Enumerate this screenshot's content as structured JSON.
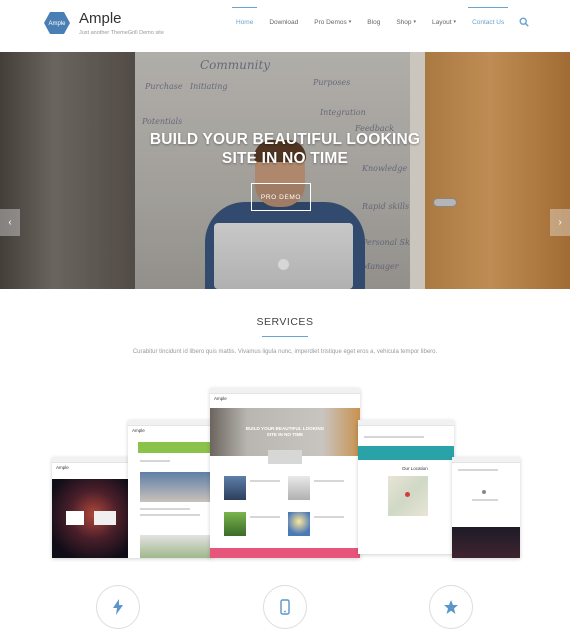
{
  "site": {
    "logo_text": "Ample",
    "title": "Ample",
    "tagline": "Just another ThemeGrill Demo site"
  },
  "nav": {
    "items": [
      {
        "label": "Home",
        "active": true
      },
      {
        "label": "Download"
      },
      {
        "label": "Pro Demos",
        "caret": "▾"
      },
      {
        "label": "Blog"
      },
      {
        "label": "Shop",
        "caret": "▾"
      },
      {
        "label": "Layout",
        "caret": "▾"
      },
      {
        "label": "Contact Us"
      }
    ]
  },
  "hero": {
    "title_line1": "BUILD YOUR BEAUTIFUL LOOKING",
    "title_line2": "SITE IN NO TIME",
    "button_label": "PRO DEMO",
    "prev_glyph": "‹",
    "next_glyph": "›",
    "whiteboard_words": [
      "Community",
      "Purchase",
      "Initiating",
      "Purposes",
      "Potentials",
      "Integration",
      "Feedback",
      "Knowledge",
      "Rapid skills",
      "Personal Skills",
      "Manager"
    ]
  },
  "services": {
    "title": "SERVICES",
    "description": "Curabitur tincidunt id libero quis mattis. Vivamus ligula nunc, imperdiet tristique eget eros a, vehicula tempor libero."
  },
  "mockups": {
    "brand": "Ample",
    "center_title_line1": "BUILD YOUR BEAUTIFUL LOOKING",
    "center_title_line2": "SITE IN NO TIME",
    "location_label": "Our Location",
    "accent_green": "#8bc34a",
    "accent_pink": "#e8557b",
    "accent_teal": "#2aa3a8"
  },
  "features": {
    "icons": [
      "bolt-icon",
      "mobile-icon",
      "star-icon"
    ]
  },
  "colors": {
    "accent": "#6aa3d0",
    "logo": "#4a7fb5"
  }
}
